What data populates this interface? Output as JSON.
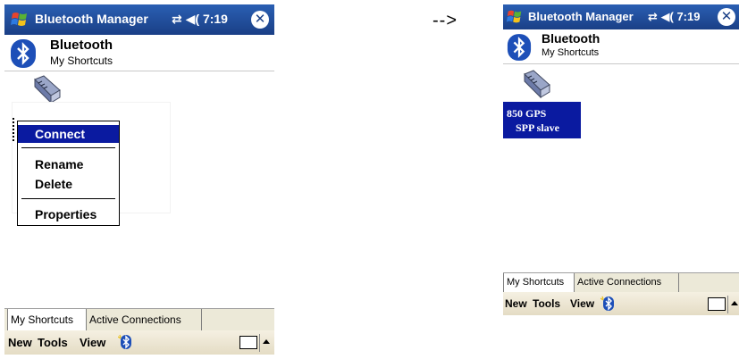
{
  "arrow": "-->",
  "left": {
    "titlebar": {
      "title": "Bluetooth Manager",
      "status": "⇄ ◀( 7:19",
      "close": "✕"
    },
    "header": {
      "title": "Bluetooth",
      "subtitle": "My Shortcuts"
    },
    "context_menu": {
      "connect": "Connect",
      "rename": "Rename",
      "delete": "Delete",
      "properties": "Properties"
    },
    "tabs": {
      "my_shortcuts": "My Shortcuts",
      "active_connections": "Active Connections"
    },
    "menubar": {
      "new": "New",
      "tools": "Tools",
      "view": "View"
    }
  },
  "right": {
    "titlebar": {
      "title": "Bluetooth Manager",
      "status": "⇄ ◀( 7:19",
      "close": "✕"
    },
    "header": {
      "title": "Bluetooth",
      "subtitle": "My Shortcuts"
    },
    "shortcut": {
      "line1": "850 GPS",
      "line2": "SPP slave"
    },
    "tabs": {
      "my_shortcuts": "My Shortcuts",
      "active_connections": "Active Connections"
    },
    "menubar": {
      "new": "New",
      "tools": "Tools",
      "view": "View"
    }
  },
  "colors": {
    "titlebar": "#1a3f86",
    "selection": "#0a1aa0",
    "menubar": "#ece9d8"
  }
}
